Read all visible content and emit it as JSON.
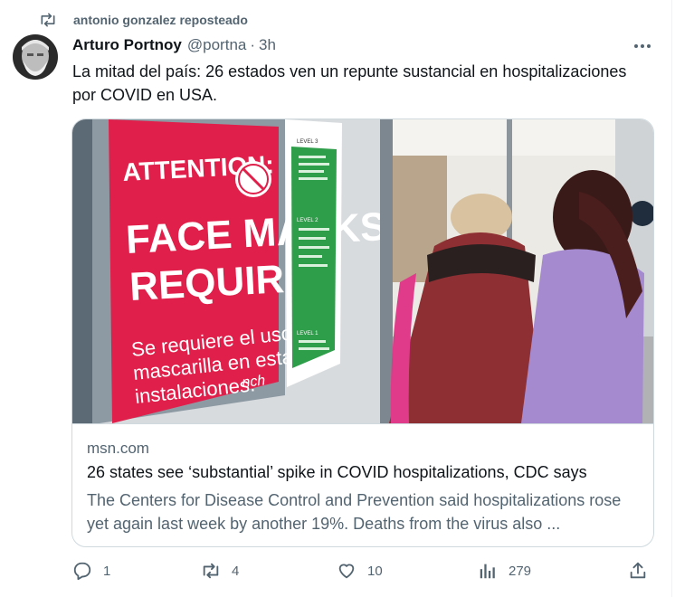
{
  "repost": {
    "text": "antonio gonzalez reposteado",
    "icon": "repost-icon"
  },
  "author": {
    "name": "Arturo Portnoy",
    "handle": "@portna",
    "separator": "·",
    "time": "3h"
  },
  "tweet_text": "La mitad del país: 26 estados ven un repunte sustancial en hospitalizaciones por COVID en USA.",
  "card": {
    "image_sign": {
      "attention": "ATTENTION:",
      "main": [
        "FACE MASKS",
        "REQUIRED"
      ],
      "spanish": [
        "Se requiere el uso de",
        "mascarilla en estas",
        "instalaciones."
      ],
      "brand": "nch",
      "directory_levels": [
        "LEVEL 3",
        "LEVEL 2",
        "LEVEL 1"
      ]
    },
    "domain": "msn.com",
    "title": "26 states see ‘substantial’ spike in COVID hospitalizations, CDC says",
    "description": "The Centers for Disease Control and Prevention said hospitalizations rose yet again last week by another 19%. Deaths from the virus also ..."
  },
  "actions": {
    "replies": "1",
    "reposts": "4",
    "likes": "10",
    "views": "279"
  },
  "colors": {
    "sign_red": "#e0204a",
    "secondary_text": "#536471",
    "border": "#cfd9de"
  }
}
